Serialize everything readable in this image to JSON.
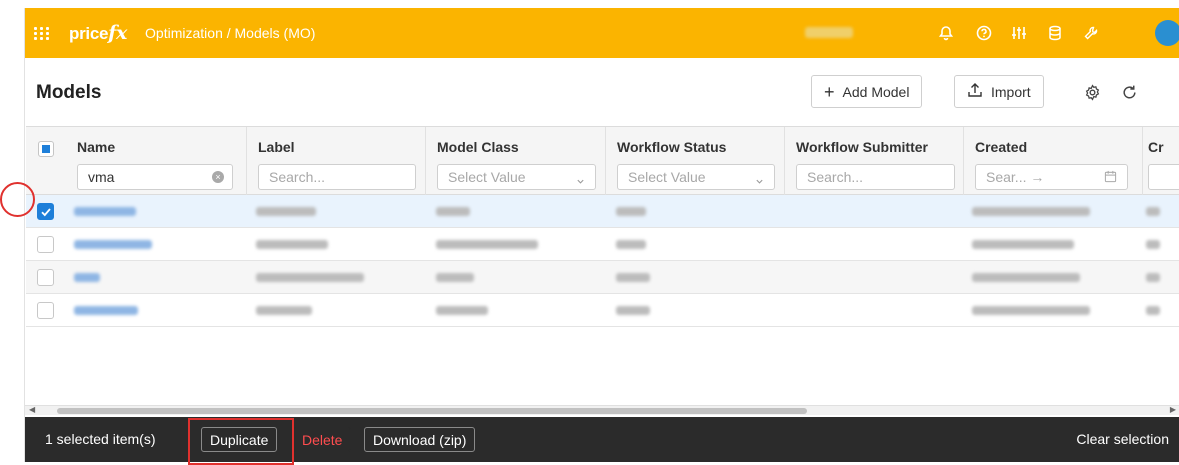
{
  "topbar": {
    "logo_main": "price",
    "logo_fx": "fx",
    "breadcrumb": "Optimization  /  Models (MO)",
    "color": "#fbb400",
    "icons": [
      "apps-grid-icon",
      "bell-icon",
      "help-icon",
      "sliders-icon",
      "database-icon",
      "tools-icon",
      "avatar"
    ]
  },
  "page": {
    "title": "Models",
    "add_model_label": "Add Model",
    "import_label": "Import"
  },
  "grid": {
    "columns": [
      {
        "title": "Name",
        "filter_value": "vma",
        "filter_type": "text"
      },
      {
        "title": "Label",
        "filter_placeholder": "Search...",
        "filter_type": "text"
      },
      {
        "title": "Model Class",
        "filter_placeholder": "Select Value",
        "filter_type": "select"
      },
      {
        "title": "Workflow Status",
        "filter_placeholder": "Select Value",
        "filter_type": "select"
      },
      {
        "title": "Workflow Submitter",
        "filter_placeholder": "Search...",
        "filter_type": "text"
      },
      {
        "title": "Created",
        "filter_placeholder": "Sear... →",
        "filter_type": "date"
      },
      {
        "title": "Cr",
        "filter_placeholder": "",
        "filter_type": "text"
      }
    ],
    "rows": [
      {
        "selected": true
      },
      {
        "selected": false
      },
      {
        "selected": false
      },
      {
        "selected": false
      }
    ]
  },
  "bottombar": {
    "selected_count": "1 selected item(s)",
    "duplicate_label": "Duplicate",
    "delete_label": "Delete",
    "download_label": "Download (zip)",
    "clear_label": "Clear selection"
  },
  "colors": {
    "accent": "#1e7fd9",
    "highlight": "#e0312e",
    "danger": "#ff4d4f"
  }
}
